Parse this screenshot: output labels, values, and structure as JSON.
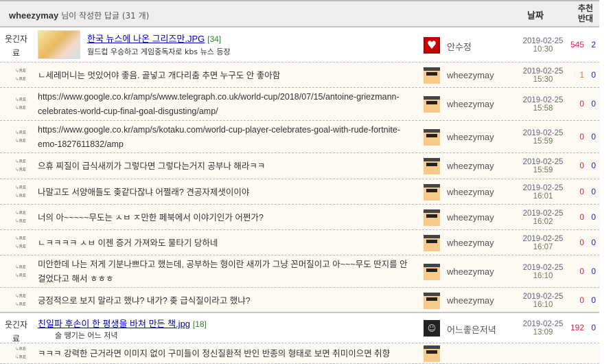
{
  "header": {
    "user": "wheezymay",
    "suffix": "님이 작성한 답글",
    "count": "(31 개)",
    "date_col": "날짜",
    "rec_col": "추천",
    "opp_col": "반대"
  },
  "posts": [
    {
      "category": "웃긴자료",
      "title": "한국 뉴스에 나온 그리즈만.JPG",
      "comments": "[34]",
      "subtitle": "월드컵 우승하고 게임중독자로 kbs 뉴스 등장",
      "nick": "안수정",
      "date": "2019-02-25",
      "time": "10:30",
      "up": "545",
      "down": "2"
    },
    {
      "category": "웃긴자료",
      "title": "친일파 후손이 한 평생을 바쳐 만든 책.jpg",
      "comments": "[18]",
      "subtitle": "술 땡기는 어느 저녁",
      "nick": "어느좋은저녁",
      "date": "2019-02-25",
      "time": "13:09",
      "up": "192",
      "down": "0"
    }
  ],
  "re_label": "RE",
  "replies": [
    {
      "text": "ㄴ세레머니는 멋있어야 좋음. 골넣고 개다리춤 추면 누구도 안 좋아함",
      "nick": "wheezymay",
      "date": "2019-02-25",
      "time": "15:30",
      "up": "1",
      "down": "0"
    },
    {
      "text": "https://www.google.co.kr/amp/s/www.telegraph.co.uk/world-cup/2018/07/15/antoine-griezmann-celebrates-world-cup-final-goal-disgusting/amp/",
      "nick": "wheezymay",
      "date": "2019-02-25",
      "time": "15:58",
      "up": "0",
      "down": "0"
    },
    {
      "text": "https://www.google.co.kr/amp/s/kotaku.com/world-cup-player-celebrates-goal-with-rude-fortnite-emo-1827611832/amp",
      "nick": "wheezymay",
      "date": "2019-02-25",
      "time": "15:59",
      "up": "0",
      "down": "0"
    },
    {
      "text": "으휴 찌질이 급식새끼가 그렇다면 그렇다는거지 공부나 해라ㅋㅋ",
      "nick": "wheezymay",
      "date": "2019-02-25",
      "time": "15:59",
      "up": "0",
      "down": "0"
    },
    {
      "text": "나말고도 서양애들도 좆같다잖냐 어쩔래? 견공자제샛이이야",
      "nick": "wheezymay",
      "date": "2019-02-25",
      "time": "16:01",
      "up": "0",
      "down": "0"
    },
    {
      "text": "너의 아~~~~~무도는 ㅅㅂ ㅈ만한 페북에서 이야기인가 어쩐가?",
      "nick": "wheezymay",
      "date": "2019-02-25",
      "time": "16:02",
      "up": "0",
      "down": "0"
    },
    {
      "text": "ㄴㅋㅋㅋㅋ ㅅㅂ 이젠 증거 가져와도 물타기 당하네",
      "nick": "wheezymay",
      "date": "2019-02-25",
      "time": "16:07",
      "up": "0",
      "down": "0"
    },
    {
      "text": "미안한데 나는 저게 기분나쁘다고 했는데, 공부하는 형이란 새끼가 그냥 꼰머질이고 아~~~무도 딴지를 안 걸었다고 해서 ㅎㅎㅎ",
      "nick": "wheezymay",
      "date": "2019-02-25",
      "time": "16:10",
      "up": "0",
      "down": "0"
    },
    {
      "text": "긍정적으로 보지 말라고 했냐? 내가? 좆 급식질이라고 했냐?",
      "nick": "wheezymay",
      "date": "2019-02-25",
      "time": "16:10",
      "up": "0",
      "down": "0"
    },
    {
      "text": "ㅋㅋㅋ 강력한 근거라면 이미지 없이 구미들이 정신질환적 반인 반종의 형태로 보면 취미이으면 취향",
      "nick": "",
      "date": "",
      "time": "",
      "up": "",
      "down": ""
    }
  ]
}
